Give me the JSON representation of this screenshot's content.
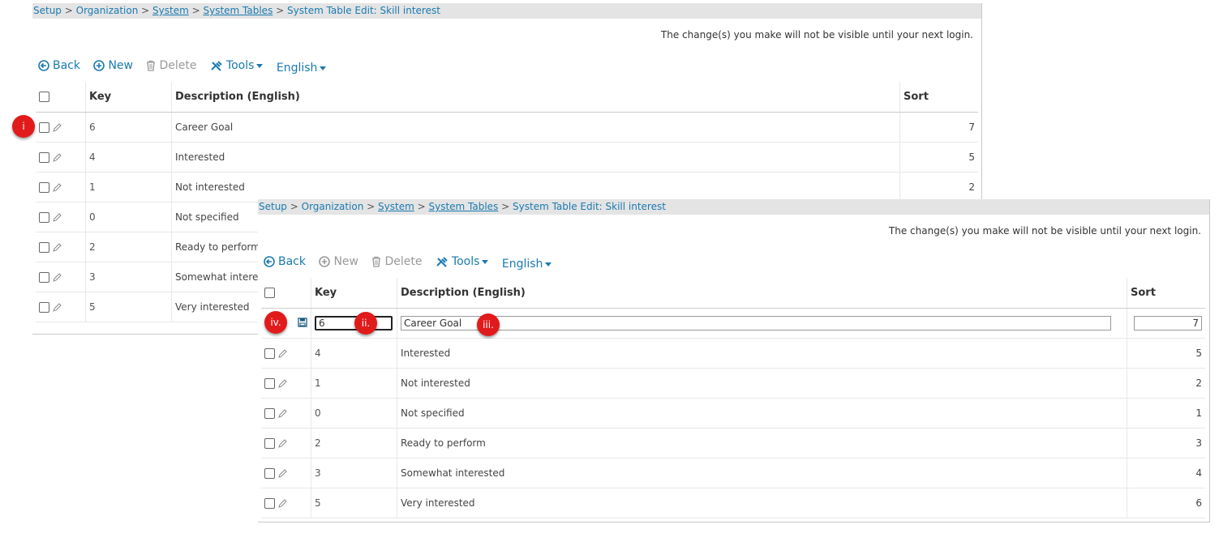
{
  "panel1": {
    "breadcrumb": [
      "Setup",
      "Organization",
      "System",
      "System Tables",
      "System Table Edit: Skill interest"
    ],
    "notice": "The change(s) you make will not be visible until your next login.",
    "toolbar": {
      "back": "Back",
      "new": "New",
      "delete": "Delete",
      "tools": "Tools",
      "language": "English"
    },
    "columns": {
      "key": "Key",
      "description": "Description (English)",
      "sort": "Sort"
    },
    "rows": [
      {
        "key": "6",
        "desc": "Career Goal",
        "sort": "7"
      },
      {
        "key": "4",
        "desc": "Interested",
        "sort": "5"
      },
      {
        "key": "1",
        "desc": "Not interested",
        "sort": "2"
      },
      {
        "key": "0",
        "desc": "Not specified",
        "sort": ""
      },
      {
        "key": "2",
        "desc": "Ready to perform",
        "sort": ""
      },
      {
        "key": "3",
        "desc": "Somewhat interest",
        "sort": ""
      },
      {
        "key": "5",
        "desc": "Very interested",
        "sort": ""
      }
    ]
  },
  "panel2": {
    "breadcrumb": [
      "Setup",
      "Organization",
      "System",
      "System Tables",
      "System Table Edit: Skill interest"
    ],
    "notice": "The change(s) you make will not be visible until your next login.",
    "toolbar": {
      "back": "Back",
      "new": "New",
      "delete": "Delete",
      "tools": "Tools",
      "language": "English"
    },
    "columns": {
      "key": "Key",
      "description": "Description (English)",
      "sort": "Sort"
    },
    "edit_row": {
      "key": "6",
      "desc": "Career Goal",
      "sort": "7"
    },
    "rows": [
      {
        "key": "4",
        "desc": "Interested",
        "sort": "5"
      },
      {
        "key": "1",
        "desc": "Not interested",
        "sort": "2"
      },
      {
        "key": "0",
        "desc": "Not specified",
        "sort": "1"
      },
      {
        "key": "2",
        "desc": "Ready to perform",
        "sort": "3"
      },
      {
        "key": "3",
        "desc": "Somewhat interested",
        "sort": "4"
      },
      {
        "key": "5",
        "desc": "Very interested",
        "sort": "6"
      }
    ]
  },
  "markers": {
    "m1": "i",
    "m2": "ii.",
    "m3": "iii.",
    "m4": "iv."
  },
  "colors": {
    "link": "#1a7ab0",
    "marker": "#e11b1b",
    "header_bar": "#e4e4e4"
  }
}
